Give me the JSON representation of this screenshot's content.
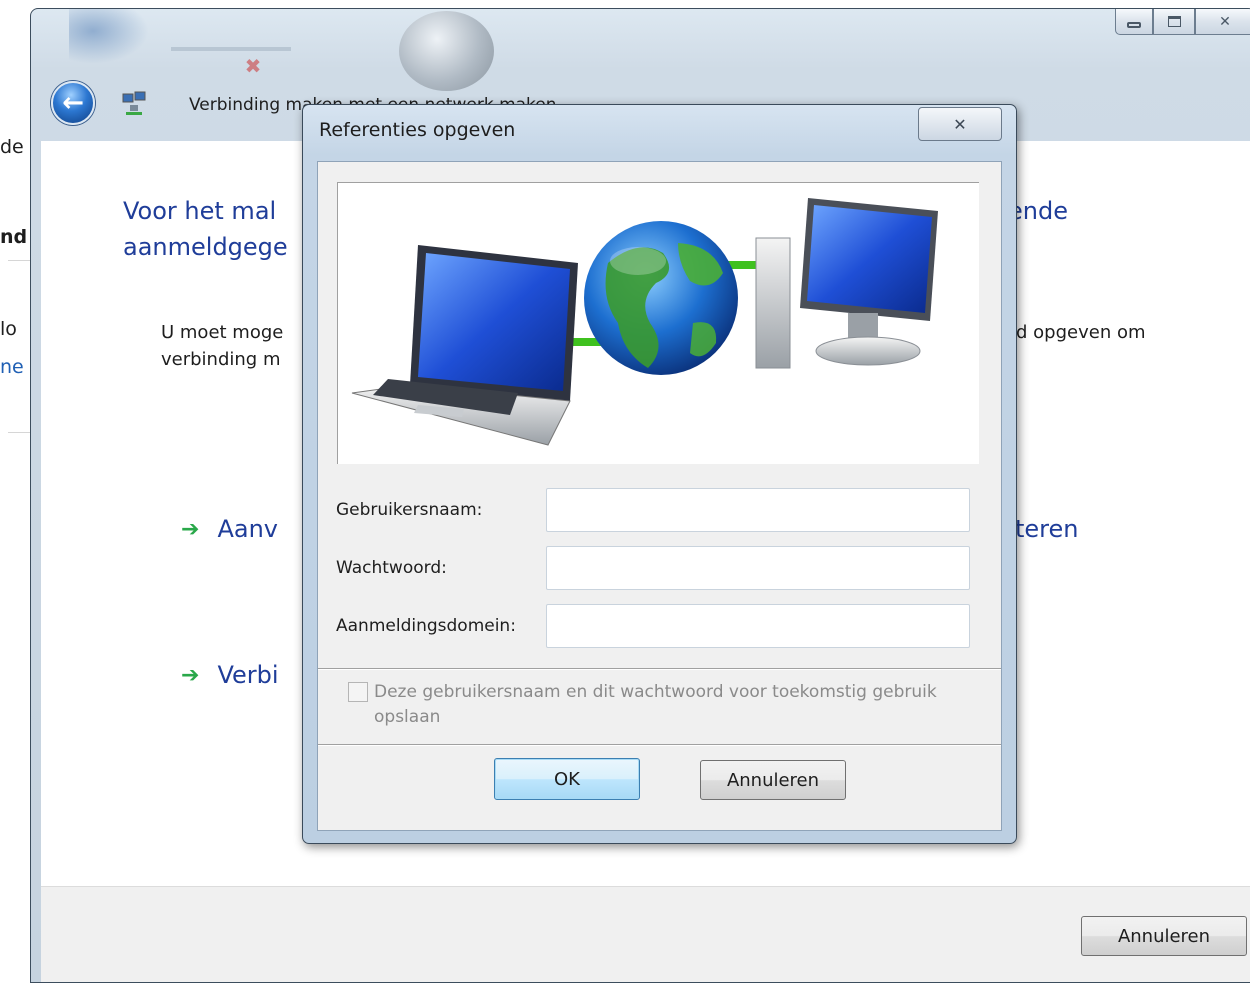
{
  "background_window": {
    "fragments": [
      "de",
      "nd",
      "lo",
      "ne"
    ]
  },
  "wizard": {
    "title": "Verbinding maken met een netwerk maken",
    "heading_left": "Voor het mal",
    "heading_left_2": "aanmeldgege",
    "heading_right": "ende",
    "description_left": "U moet moge",
    "description_left_2": "verbinding m",
    "description_right": "d opgeven om",
    "option_1_left": "Aanv",
    "option_1_right": "teren",
    "option_2_left": "Verbi",
    "footer_cancel_label": "Annuleren"
  },
  "dialog": {
    "title": "Referenties opgeven",
    "fields": [
      {
        "label": "Gebruikersnaam:",
        "value": ""
      },
      {
        "label": "Wachtwoord:",
        "value": ""
      },
      {
        "label": "Aanmeldingsdomein:",
        "value": ""
      }
    ],
    "save_checkbox": {
      "label": "Deze gebruikersnaam en dit wachtwoord voor toekomstig gebruik opslaan",
      "checked": false,
      "enabled": false
    },
    "ok_label": "OK",
    "cancel_label": "Annuleren"
  },
  "icons": {
    "back": "back-arrow-icon",
    "wizard": "network-connection-icon",
    "close": "close-icon",
    "minimize": "minimize-icon",
    "maximize": "maximize-icon",
    "option_arrow": "green-arrow-icon"
  },
  "colors": {
    "link_blue": "#1f3d99",
    "arrow_green": "#2aa84a",
    "ok_focus": "#3c7fb1"
  }
}
